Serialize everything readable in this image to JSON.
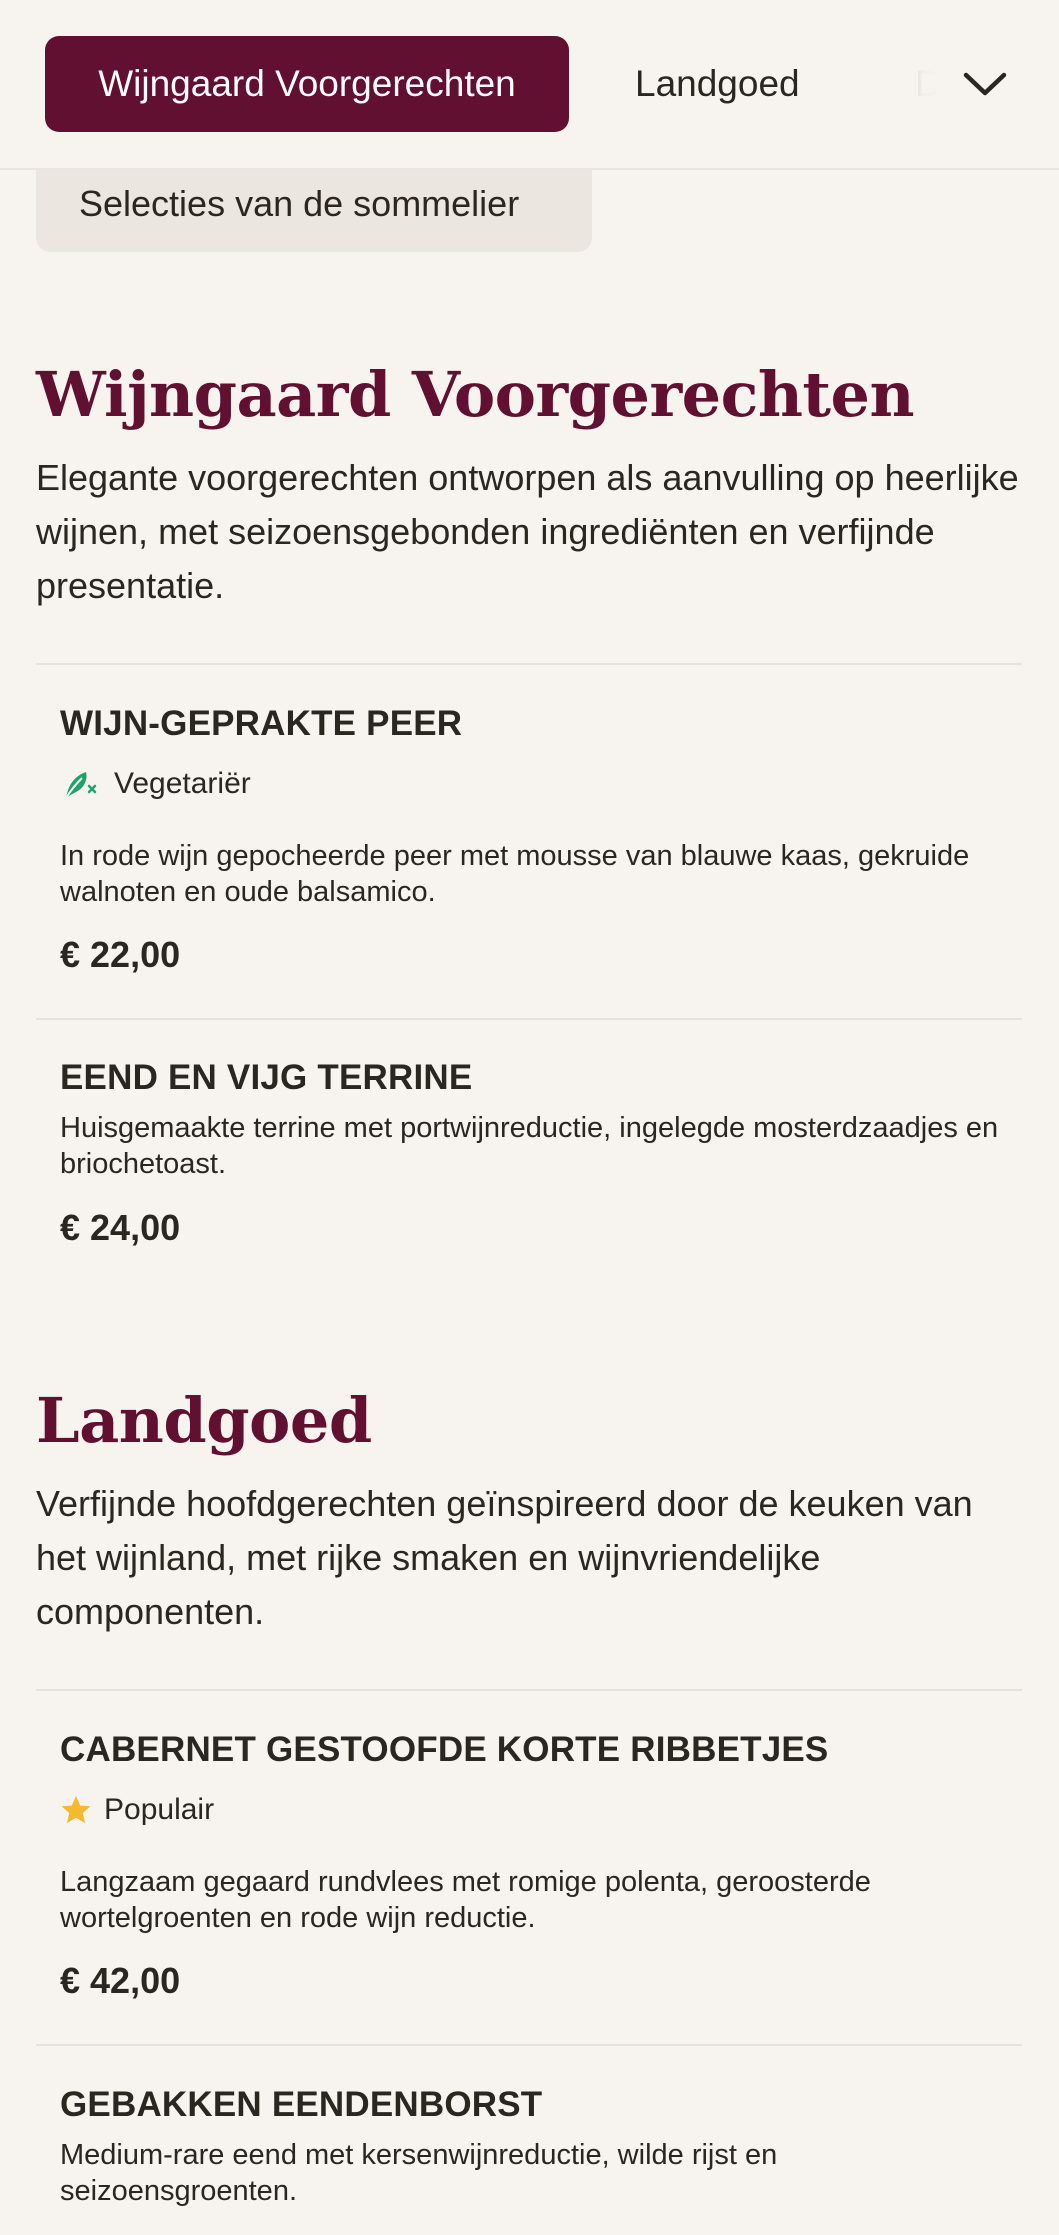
{
  "nav": {
    "tabs": [
      {
        "label": "Wijngaard Voorgerechten",
        "active": true
      },
      {
        "label": "Landgoed",
        "active": false
      },
      {
        "label": "D",
        "active": false
      }
    ],
    "second_row_tab": "Selecties van de sommelier",
    "expand_icon": "chevron-down-icon"
  },
  "sections": [
    {
      "title": "Wijngaard Voorgerechten",
      "description": "Elegante voorgerechten ontworpen als aanvulling op heerlijke wijnen, met seizoensgebonden ingrediënten en verfijnde presentatie.",
      "items": [
        {
          "name": "WIJN-GEPRAKTE PEER",
          "tag": "Vegetariër",
          "tag_icon": "vegetarian-leaf-icon",
          "description": "In rode wijn gepocheerde peer met mousse van blauwe kaas, gekruide walnoten en oude balsamico.",
          "price": "€ 22,00"
        },
        {
          "name": "EEND EN VIJG TERRINE",
          "description": "Huisgemaakte terrine met portwijnreductie, ingelegde mosterdzaadjes en briochetoast.",
          "price": "€ 24,00"
        }
      ]
    },
    {
      "title": "Landgoed",
      "description": "Verfijnde hoofdgerechten geïnspireerd door de keuken van het wijnland, met rijke smaken en wijnvriendelijke componenten.",
      "items": [
        {
          "name": "CABERNET GESTOOFDE KORTE RIBBETJES",
          "tag": "Populair",
          "tag_icon": "star-icon",
          "description": "Langzaam gegaard rundvlees met romige polenta, geroosterde wortelgroenten en rode wijn reductie.",
          "price": "€ 42,00"
        },
        {
          "name": "GEBAKKEN EENDENBORST",
          "description": "Medium-rare eend met kersenwijnreductie, wilde rijst en seizoensgroenten."
        }
      ]
    }
  ],
  "colors": {
    "accent": "#621032",
    "background": "#f7f4ef",
    "vegetarian": "#1fa36a",
    "star": "#f5b82e"
  }
}
